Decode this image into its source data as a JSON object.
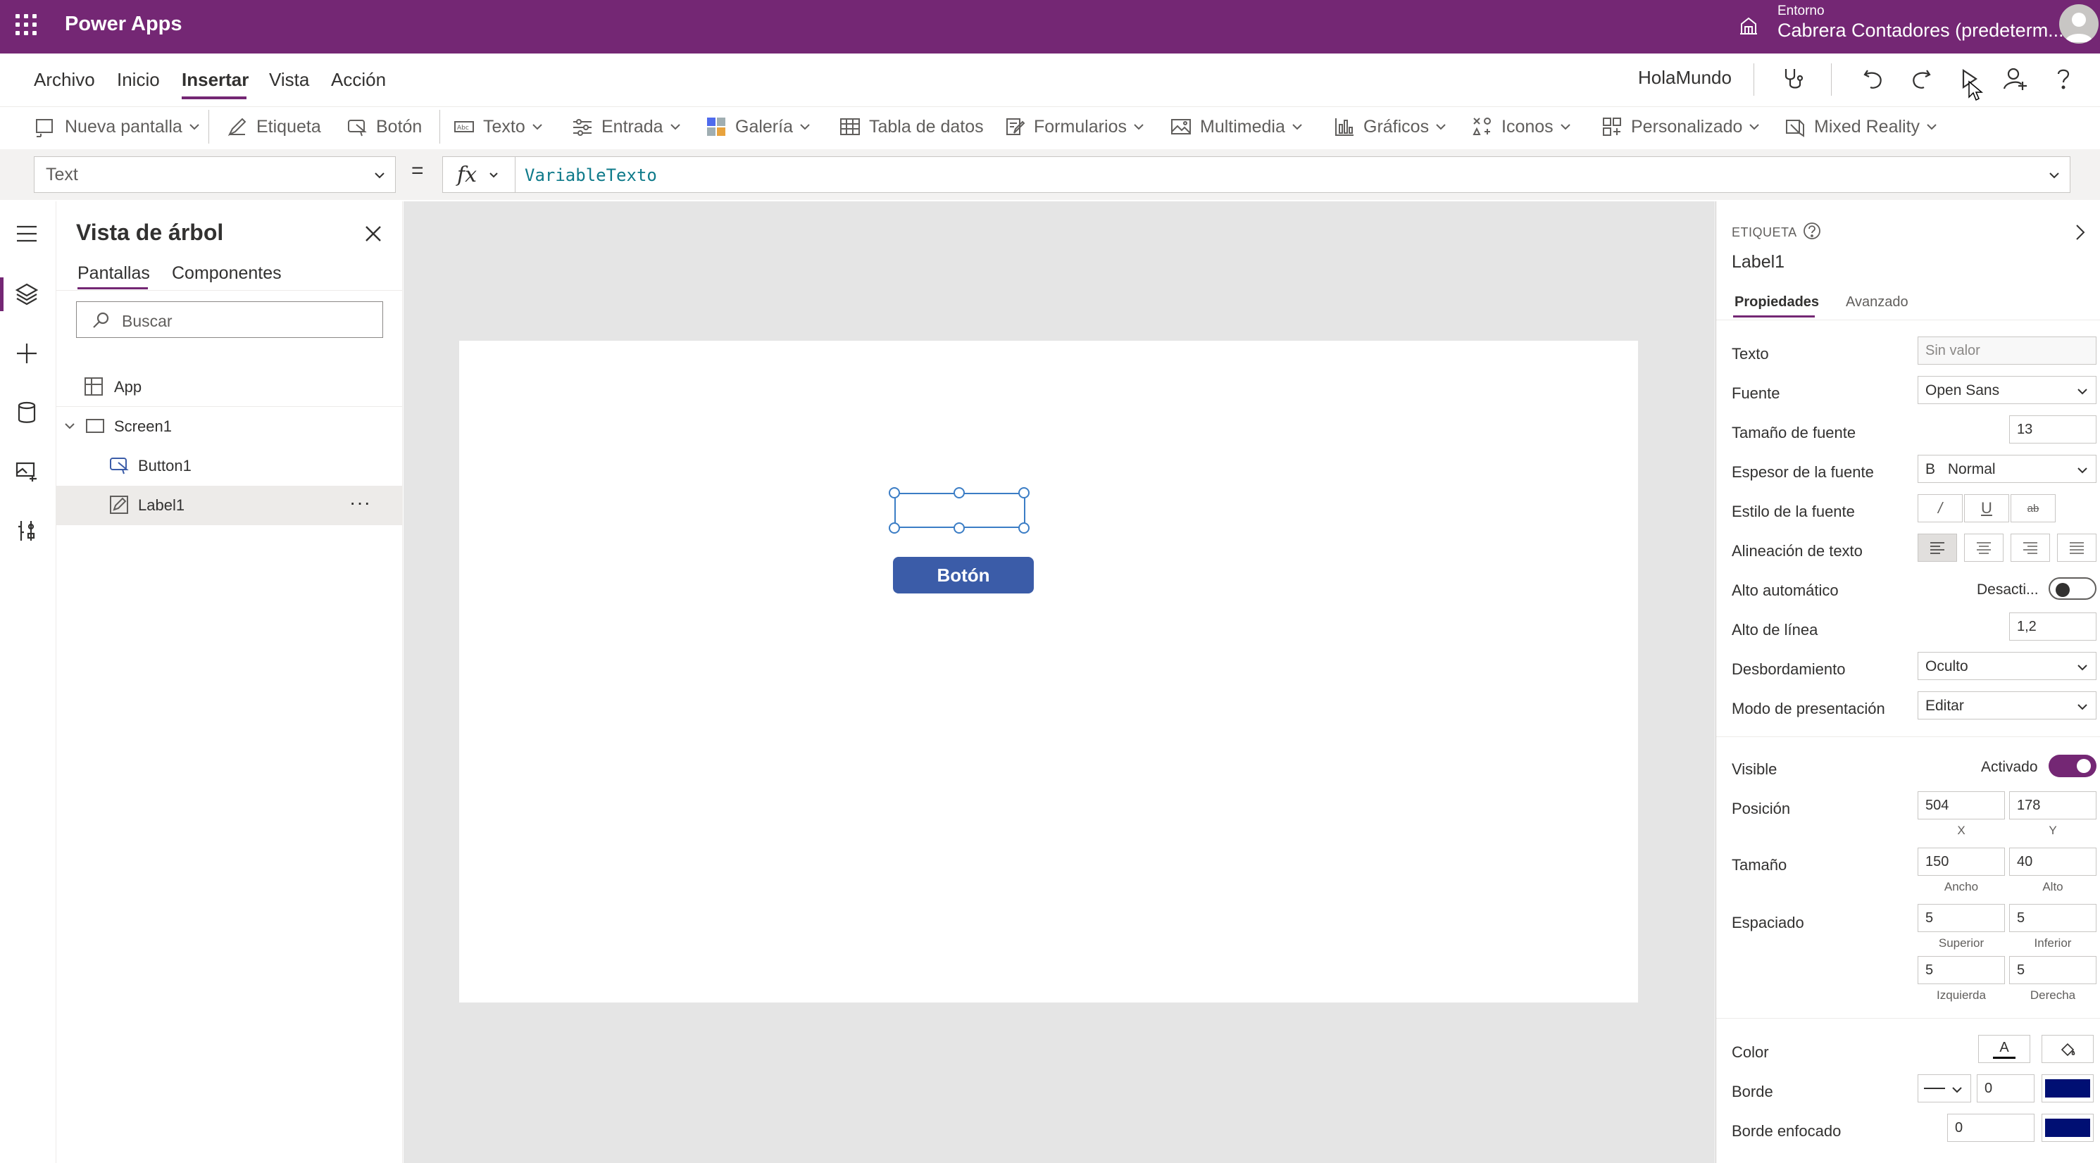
{
  "appbar": {
    "title": "Power Apps",
    "environment_label": "Entorno",
    "environment_name": "Cabrera Contadores (predeterm..."
  },
  "menu": {
    "items": [
      "Archivo",
      "Inicio",
      "Insertar",
      "Vista",
      "Acción"
    ],
    "active": "Insertar",
    "app_name": "HolaMundo"
  },
  "ribbon": {
    "items": [
      "Nueva pantalla",
      "Etiqueta",
      "Botón",
      "Texto",
      "Entrada",
      "Galería",
      "Tabla de datos",
      "Formularios",
      "Multimedia",
      "Gráficos",
      "Iconos",
      "Personalizado",
      "Mixed Reality"
    ]
  },
  "formula_bar": {
    "property": "Text",
    "equals": "=",
    "fx": "fx",
    "formula": "VariableTexto"
  },
  "tree": {
    "title": "Vista de árbol",
    "tabs": [
      "Pantallas",
      "Componentes"
    ],
    "search_placeholder": "Buscar",
    "nodes": [
      "App",
      "Screen1",
      "Button1",
      "Label1"
    ],
    "selected": "Label1",
    "more": "···"
  },
  "canvas": {
    "button_label": "Botón"
  },
  "properties": {
    "control_type": "ETIQUETA",
    "control_name": "Label1",
    "tabs": [
      "Propiedades",
      "Avanzado"
    ],
    "texto": {
      "label": "Texto",
      "placeholder": "Sin valor"
    },
    "fuente": {
      "label": "Fuente",
      "value": "Open Sans"
    },
    "tamano_fuente": {
      "label": "Tamaño de fuente",
      "value": "13"
    },
    "espesor": {
      "label": "Espesor de la fuente",
      "prefix": "B",
      "value": "Normal"
    },
    "estilo": {
      "label": "Estilo de la fuente",
      "buttons": [
        "/",
        "U",
        "ab"
      ]
    },
    "alineacion": {
      "label": "Alineación de texto"
    },
    "alto_auto": {
      "label": "Alto automático",
      "state": "Desacti..."
    },
    "alto_linea": {
      "label": "Alto de línea",
      "value": "1,2"
    },
    "desbordamiento": {
      "label": "Desbordamiento",
      "value": "Oculto"
    },
    "modo": {
      "label": "Modo de presentación",
      "value": "Editar"
    },
    "visible": {
      "label": "Visible",
      "state": "Activado"
    },
    "posicion": {
      "label": "Posición",
      "x": "504",
      "y": "178",
      "x_label": "X",
      "y_label": "Y"
    },
    "tamano": {
      "label": "Tamaño",
      "w": "150",
      "h": "40",
      "w_label": "Ancho",
      "h_label": "Alto"
    },
    "espaciado": {
      "label": "Espaciado",
      "top": "5",
      "bottom": "5",
      "left": "5",
      "right": "5",
      "top_label": "Superior",
      "bottom_label": "Inferior",
      "left_label": "Izquierda",
      "right_label": "Derecha"
    },
    "color": {
      "label": "Color",
      "text_glyph": "A"
    },
    "borde": {
      "label": "Borde",
      "value": "0",
      "color": "#000f73"
    },
    "borde_enfocado": {
      "label": "Borde enfocado",
      "value": "0"
    }
  },
  "colors": {
    "brand": "#742774",
    "button": "#3b5ca8",
    "selection": "#3b7dc5",
    "formula": "#0e7a8a"
  }
}
